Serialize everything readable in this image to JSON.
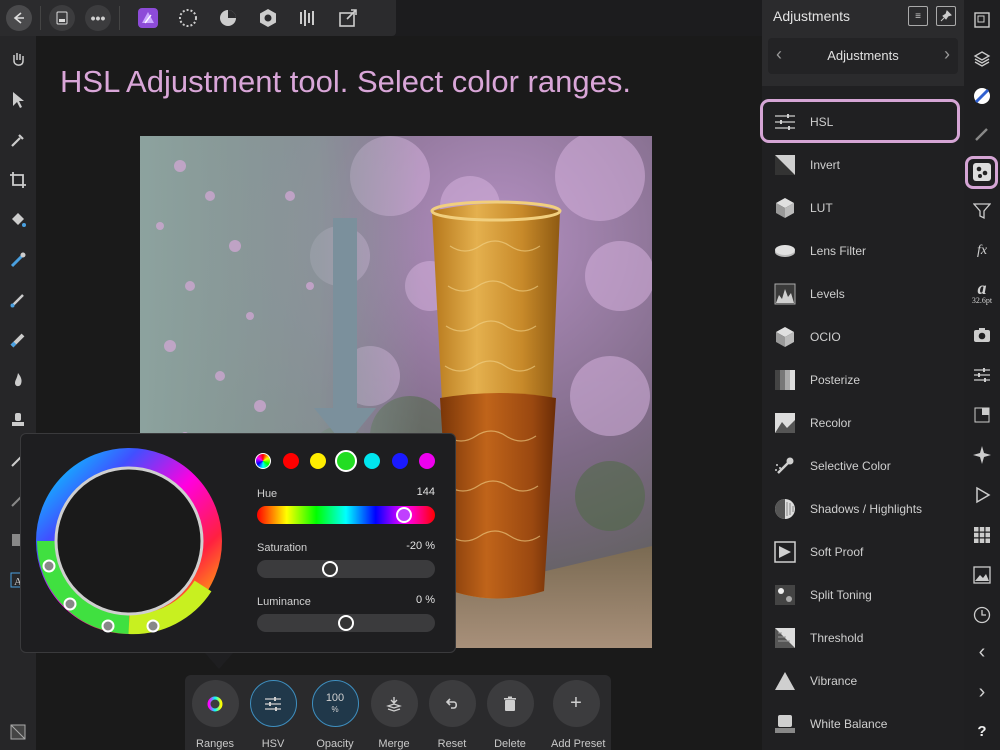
{
  "hint_text": "HSL Adjustment tool. Select color ranges.",
  "topbar": {
    "icons": [
      "back-icon",
      "document-icon",
      "more-icon",
      "photo-persona-icon",
      "liquify-persona-icon",
      "develop-persona-icon",
      "tone-mapping-persona-icon",
      "export-persona-icon"
    ]
  },
  "hsl": {
    "swatches": [
      {
        "name": "master",
        "color": "wheel"
      },
      {
        "name": "red",
        "color": "#ff0000"
      },
      {
        "name": "yellow",
        "color": "#ffee00"
      },
      {
        "name": "green",
        "color": "#22dd22",
        "selected": true
      },
      {
        "name": "cyan",
        "color": "#00e5ee"
      },
      {
        "name": "blue",
        "color": "#1a1aff"
      },
      {
        "name": "magenta",
        "color": "#ee00ee"
      }
    ],
    "hue_label": "Hue",
    "hue_value": "144",
    "hue_fraction": 0.86,
    "saturation_label": "Saturation",
    "saturation_value": "-20 %",
    "saturation_fraction": 0.4,
    "luminance_label": "Luminance",
    "luminance_value": "0 %",
    "luminance_fraction": 0.5
  },
  "context_toolbar": {
    "ranges": "Ranges",
    "hsv": "HSV",
    "opacity": "Opacity",
    "opacity_value": "100",
    "opacity_unit": "%",
    "merge": "Merge",
    "reset": "Reset",
    "delete": "Delete",
    "add_preset": "Add Preset"
  },
  "panel": {
    "title": "Adjustments",
    "nav_label": "Adjustments",
    "items": [
      {
        "label": "HSL",
        "icon": "sliders-icon"
      },
      {
        "label": "Invert",
        "icon": "invert-icon"
      },
      {
        "label": "LUT",
        "icon": "cube-icon"
      },
      {
        "label": "Lens Filter",
        "icon": "lens-filter-icon"
      },
      {
        "label": "Levels",
        "icon": "levels-icon"
      },
      {
        "label": "OCIO",
        "icon": "ocio-cube-icon"
      },
      {
        "label": "Posterize",
        "icon": "posterize-icon"
      },
      {
        "label": "Recolor",
        "icon": "recolor-icon"
      },
      {
        "label": "Selective Color",
        "icon": "dropper-icon"
      },
      {
        "label": "Shadows / Highlights",
        "icon": "shadows-highlights-icon"
      },
      {
        "label": "Soft Proof",
        "icon": "soft-proof-icon"
      },
      {
        "label": "Split Toning",
        "icon": "split-toning-icon"
      },
      {
        "label": "Threshold",
        "icon": "threshold-icon"
      },
      {
        "label": "Vibrance",
        "icon": "vibrance-icon"
      },
      {
        "label": "White Balance",
        "icon": "white-balance-icon"
      }
    ]
  },
  "strip": {
    "font_size": "32.6pt",
    "help": "?"
  },
  "colors": {
    "highlight": "#d5a5d5",
    "arrow": "#7b909c",
    "hint": "#d9a6d8"
  }
}
